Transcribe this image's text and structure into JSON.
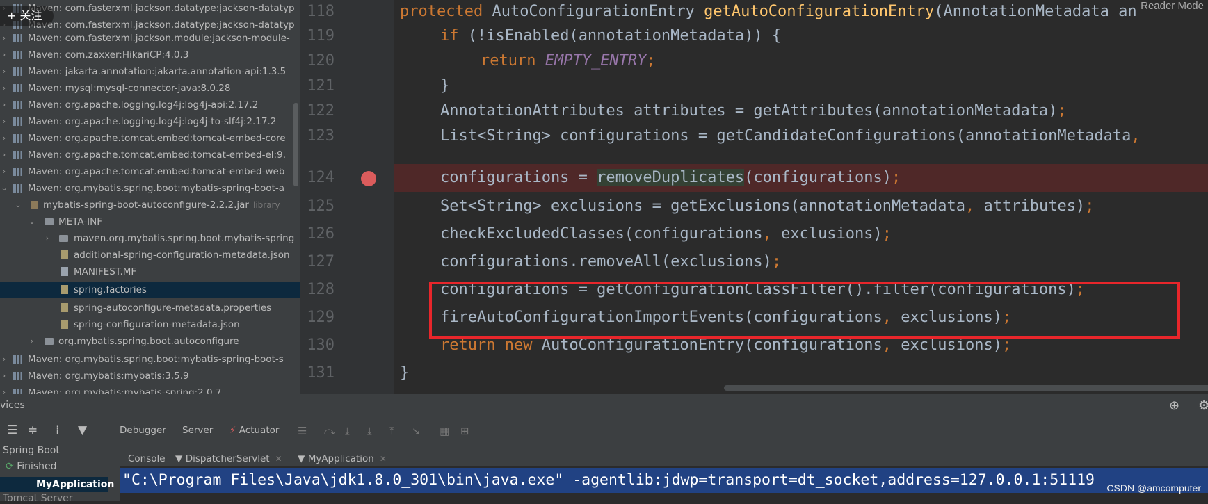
{
  "follow_button": {
    "label": "+ 关注"
  },
  "tree": {
    "rows": [
      {
        "label": "Maven: com.fasterxml.jackson.datatype:jackson-datatyp",
        "icon": "library-icon"
      },
      {
        "label": "Maven: com.fasterxml.jackson.datatype:jackson-datatyp",
        "icon": "library-icon"
      },
      {
        "label": "Maven: com.fasterxml.jackson.module:jackson-module-",
        "icon": "library-icon"
      },
      {
        "label": "Maven: com.zaxxer:HikariCP:4.0.3",
        "icon": "library-icon"
      },
      {
        "label": "Maven: jakarta.annotation:jakarta.annotation-api:1.3.5",
        "icon": "library-icon"
      },
      {
        "label": "Maven: mysql:mysql-connector-java:8.0.28",
        "icon": "library-icon"
      },
      {
        "label": "Maven: org.apache.logging.log4j:log4j-api:2.17.2",
        "icon": "library-icon"
      },
      {
        "label": "Maven: org.apache.logging.log4j:log4j-to-slf4j:2.17.2",
        "icon": "library-icon"
      },
      {
        "label": "Maven: org.apache.tomcat.embed:tomcat-embed-core",
        "icon": "library-icon"
      },
      {
        "label": "Maven: org.apache.tomcat.embed:tomcat-embed-el:9.",
        "icon": "library-icon"
      },
      {
        "label": "Maven: org.apache.tomcat.embed:tomcat-embed-web",
        "icon": "library-icon"
      },
      {
        "label": "Maven: org.mybatis.spring.boot:mybatis-spring-boot-a",
        "icon": "library-icon"
      },
      {
        "label": "mybatis-spring-boot-autoconfigure-2.2.2.jar",
        "suffix": "library",
        "icon": "jar-icon"
      },
      {
        "label": "META-INF",
        "icon": "folder-icon"
      },
      {
        "label": "maven.org.mybatis.spring.boot.mybatis-spring",
        "icon": "folder-icon"
      },
      {
        "label": "additional-spring-configuration-metadata.json",
        "icon": "json-file-icon"
      },
      {
        "label": "MANIFEST.MF",
        "icon": "manifest-file-icon"
      },
      {
        "label": "spring.factories",
        "icon": "factories-file-icon"
      },
      {
        "label": "spring-autoconfigure-metadata.properties",
        "icon": "properties-file-icon"
      },
      {
        "label": "spring-configuration-metadata.json",
        "icon": "json-file-icon"
      },
      {
        "label": "org.mybatis.spring.boot.autoconfigure",
        "icon": "package-icon"
      },
      {
        "label": "Maven: org.mybatis.spring.boot:mybatis-spring-boot-s",
        "icon": "library-icon"
      },
      {
        "label": "Maven: org.mybatis:mybatis:3.5.9",
        "icon": "library-icon"
      },
      {
        "label": "Maven: org.mybatis:mybatis-spring:2.0.7",
        "icon": "library-icon"
      }
    ],
    "selected": "spring.factories"
  },
  "editor": {
    "reader_mode": "Reader Mode",
    "lines": [
      {
        "num": "118"
      },
      {
        "num": "119"
      },
      {
        "num": "120"
      },
      {
        "num": "121"
      },
      {
        "num": "122"
      },
      {
        "num": "123"
      },
      {
        "num": "124"
      },
      {
        "num": "125"
      },
      {
        "num": "126"
      },
      {
        "num": "127"
      },
      {
        "num": "128"
      },
      {
        "num": "129"
      },
      {
        "num": "130"
      },
      {
        "num": "131"
      }
    ],
    "code": {
      "l118a": "protected ",
      "l118b": "AutoConfigurationEntry ",
      "l118c": "getAutoConfigurationEntry",
      "l118d": "(AnnotationMetadata an",
      "l119a": "if ",
      "l119b": "(!isEnabled(annotationMetadata)) {",
      "l120a": "return ",
      "l120b": "EMPTY_ENTRY",
      "l120c": ";",
      "l121": "}",
      "l122a": "AnnotationAttributes attributes = getAttributes(annotationMetadata)",
      "l122b": ";",
      "l123a": "List<String> configurations = getCandidateConfigurations(annotationMetadata",
      "l123b": ",",
      "l124a": "configurations = ",
      "l124b": "removeDuplicates",
      "l124c": "(configurations)",
      "l124d": ";",
      "l125a": "Set<String> exclusions = getExclusions(annotationMetadata",
      "l125b": ", ",
      "l125c": "attributes)",
      "l125d": ";",
      "l126a": "checkExcludedClasses(configurations",
      "l126b": ", ",
      "l126c": "exclusions)",
      "l126d": ";",
      "l127a": "configurations.removeAll(exclusions)",
      "l127b": ";",
      "l128a": "configurations = getConfigurationClassFilter().filter(configurations)",
      "l128b": ";",
      "l129a": "fireAutoConfigurationImportEvents(configurations",
      "l129b": ", ",
      "l129c": "exclusions)",
      "l129d": ";",
      "l130a": "return new ",
      "l130b": "AutoConfigurationEntry(configurations",
      "l130c": ", ",
      "l130d": "exclusions)",
      "l130e": ";",
      "l131": "}"
    },
    "breakpoint_line": "124",
    "highlight_color": "#e8262b"
  },
  "services": {
    "title": "vices",
    "tree": {
      "spring_boot": "Spring Boot",
      "finished": "Finished",
      "app": "MyApplication",
      "tomcat": "Tomcat Server"
    },
    "tabs": [
      "Debugger",
      "Server",
      "Actuator"
    ],
    "subtabs": [
      "Console",
      "DispatcherServlet",
      "MyApplication"
    ],
    "console_line": "\"C:\\Program Files\\Java\\jdk1.8.0_301\\bin\\java.exe\" -agentlib:jdwp=transport=dt_socket,address=127.0.0.1:51119"
  },
  "watermark": "CSDN @amcomputer"
}
